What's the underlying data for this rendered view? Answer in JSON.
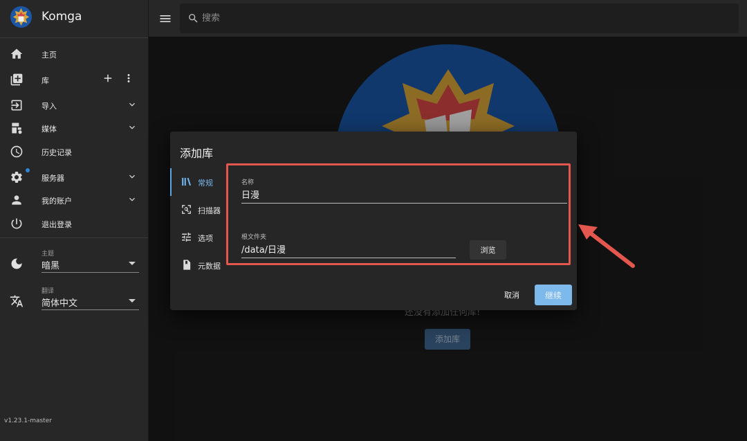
{
  "app": {
    "name": "Komga",
    "version": "v1.23.1-master"
  },
  "sidebar": {
    "items": [
      {
        "label": "主页",
        "icon": "home-icon"
      },
      {
        "label": "库",
        "icon": "library-books-icon"
      },
      {
        "label": "导入",
        "icon": "import-icon"
      },
      {
        "label": "媒体",
        "icon": "media-icon"
      },
      {
        "label": "历史记录",
        "icon": "history-icon"
      },
      {
        "label": "服务器",
        "icon": "gear-icon"
      },
      {
        "label": "我的账户",
        "icon": "account-icon"
      },
      {
        "label": "退出登录",
        "icon": "power-icon"
      }
    ],
    "theme": {
      "caption": "主题",
      "value": "暗黑"
    },
    "language": {
      "caption": "翻译",
      "value": "简体中文"
    }
  },
  "topbar": {
    "search_placeholder": "搜索"
  },
  "main": {
    "empty_message": "还没有添加任何库!",
    "add_library_label": "添加库"
  },
  "dialog": {
    "title": "添加库",
    "tabs": [
      {
        "label": "常规",
        "icon": "books-icon",
        "active": true
      },
      {
        "label": "扫描器",
        "icon": "scan-icon",
        "active": false
      },
      {
        "label": "选项",
        "icon": "tune-icon",
        "active": false
      },
      {
        "label": "元数据",
        "icon": "metadata-icon",
        "active": false
      }
    ],
    "name_caption": "名称",
    "name_value": "日漫",
    "root_caption": "根文件夹",
    "root_value": "/data/日漫",
    "browse_label": "浏览",
    "cancel_label": "取消",
    "continue_label": "继续"
  },
  "colors": {
    "accent": "#7db9ea",
    "annotation": "#e3574f",
    "background": "#1b1b1b",
    "panel": "#272727"
  }
}
